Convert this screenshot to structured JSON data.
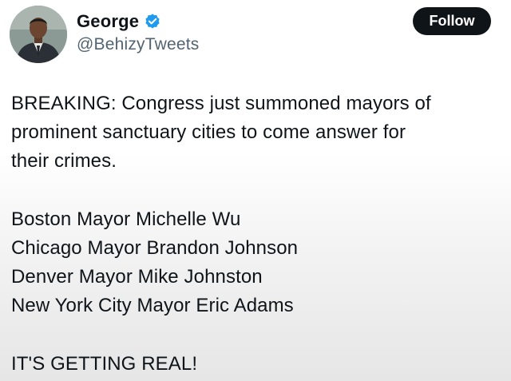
{
  "author": {
    "display_name": "George",
    "handle": "@BehizyTweets",
    "verified_icon": "verified-badge-icon",
    "verified_color": "#1d9bf0"
  },
  "actions": {
    "follow_label": "Follow"
  },
  "tweet": {
    "headline_lines": [
      "BREAKING: Congress just summoned mayors of",
      "prominent sanctuary cities to come answer for",
      "their crimes."
    ],
    "mayors": [
      "Boston Mayor Michelle Wu",
      "Chicago Mayor Brandon Johnson",
      "Denver Mayor Mike Johnston",
      "New York City Mayor Eric Adams"
    ],
    "closing": "IT'S GETTING REAL!"
  },
  "colors": {
    "text": "#0f1419",
    "secondary_text": "#536471",
    "follow_button_bg": "#0f1419",
    "follow_button_text": "#ffffff"
  }
}
